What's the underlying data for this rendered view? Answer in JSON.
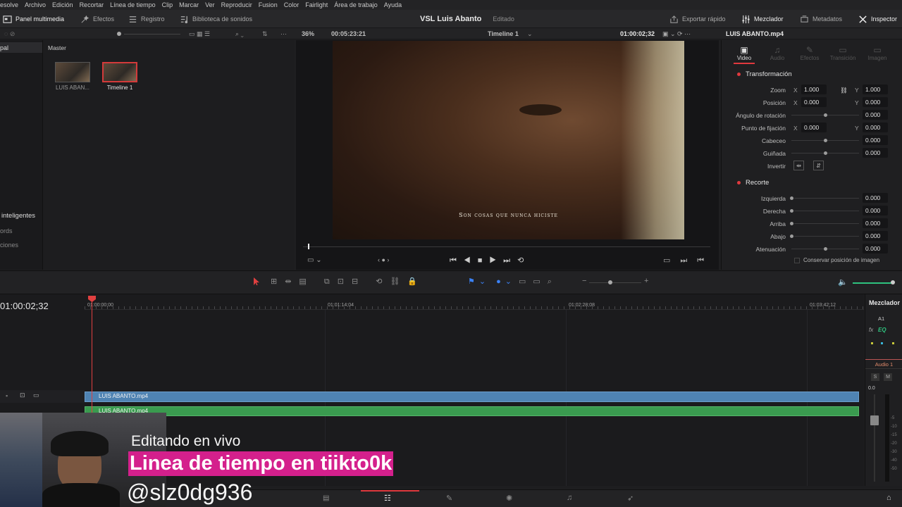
{
  "menu": [
    "esolve",
    "Archivo",
    "Edición",
    "Recortar",
    "Línea de tiempo",
    "Clip",
    "Marcar",
    "Ver",
    "Reproducir",
    "Fusion",
    "Color",
    "Fairlight",
    "Área de trabajo",
    "Ayuda"
  ],
  "toolbar": {
    "media_pool": "Panel multimedia",
    "effects": "Efectos",
    "index": "Registro",
    "sound_library": "Biblioteca de sonidos",
    "project_title": "VSL Luis Abanto",
    "project_status": "Editado",
    "quick_export": "Exportar rápido",
    "mixer": "Mezclador",
    "metadata": "Metadatos",
    "inspector": "Inspector"
  },
  "viewer": {
    "zoom": "36%",
    "duration": "00:05:23:21",
    "timeline_name": "Timeline 1",
    "timecode": "01:00:02;32",
    "subtitle": "Son cosas que nunca hiciste"
  },
  "media_pool": {
    "bin_selected": "pal",
    "master": "Master",
    "smart_bins": "inteligentes",
    "smart_items": [
      "ords",
      "ciones"
    ],
    "clips": [
      {
        "name": "LUIS ABAN...",
        "selected": false
      },
      {
        "name": "Timeline 1",
        "selected": true
      }
    ]
  },
  "inspector": {
    "file": "LUIS ABANTO.mp4",
    "tabs": [
      "Video",
      "Audio",
      "Efectos",
      "Transición",
      "Imagen"
    ],
    "active_tab": "Video",
    "transform_title": "Transformación",
    "transform": {
      "zoom_label": "Zoom",
      "zoom_x": "1.000",
      "zoom_y": "1.000",
      "position_label": "Posición",
      "position_x": "0.000",
      "position_y": "0.000",
      "rotation_label": "Ángulo de rotación",
      "rotation": "0.000",
      "anchor_label": "Punto de fijación",
      "anchor_x": "0.000",
      "anchor_y": "0.000",
      "pitch_label": "Cabeceo",
      "pitch": "0.000",
      "yaw_label": "Guiñada",
      "yaw": "0.000",
      "flip_label": "Invertir"
    },
    "crop_title": "Recorte",
    "crop": {
      "left_label": "Izquierda",
      "left": "0.000",
      "right_label": "Derecha",
      "right": "0.000",
      "top_label": "Arriba",
      "top": "0.000",
      "bottom_label": "Abajo",
      "bottom": "0.000",
      "soft_label": "Atenuación",
      "soft": "0.000",
      "retain_label": "Conservar posición de imagen"
    }
  },
  "timeline": {
    "timecode": "01:00:02;32",
    "ruler": [
      "01:00:00;00",
      "01:01:14;04",
      "01:02:28;08",
      "01:03:42;12"
    ],
    "video_clip": "LUIS ABANTO.mp4",
    "audio_clip": "LUIS ABANTO.mp4"
  },
  "mixer": {
    "title": "Mezclador",
    "channel": "A1",
    "fx": "fx",
    "eq": "EQ",
    "track": "Audio 1",
    "solo": "S",
    "mute": "M",
    "level": "0.0",
    "scale": [
      "-5",
      "-10",
      "-15",
      "-20",
      "-30",
      "-40",
      "-50"
    ]
  },
  "overlay": {
    "line1": "Editando en vivo",
    "line2": "Linea de tiempo en tiikto0k",
    "line3": "@slz0dg936"
  },
  "colors": {
    "accent_red": "#e0393e",
    "video_clip": "#4f83b3",
    "audio_clip": "#3a9b4f",
    "overlay_highlight": "#d4208c"
  }
}
